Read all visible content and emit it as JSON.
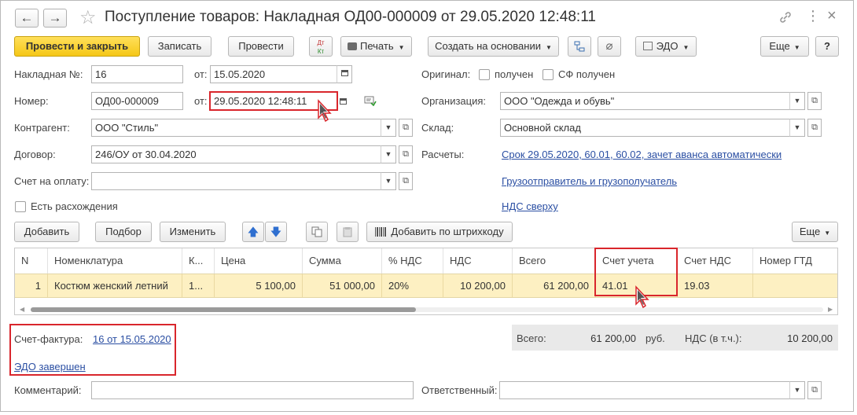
{
  "window": {
    "title": "Поступление товаров: Накладная ОД00-000009 от 29.05.2020 12:48:11",
    "nav_back": "←",
    "nav_forward": "→",
    "star": "☆",
    "link_icon": "🔗",
    "more_icon": "⋮",
    "close_icon": "×"
  },
  "toolbar": {
    "post_close": "Провести и закрыть",
    "save": "Записать",
    "post": "Провести",
    "dtkt_top": "Дт",
    "dtkt_bottom": "Кт",
    "print": "Печать",
    "create_based": "Создать на основании",
    "edo": "ЭДО",
    "more": "Еще",
    "help": "?"
  },
  "form": {
    "invoice_no_label": "Накладная №:",
    "invoice_no": "16",
    "from_label": "от:",
    "invoice_date": "15.05.2020",
    "number_label": "Номер:",
    "number": "ОД00-000009",
    "from_label2": "от:",
    "doc_date": "29.05.2020 12:48:11",
    "counterparty_label": "Контрагент:",
    "counterparty": "ООО \"Стиль\"",
    "contract_label": "Договор:",
    "contract": "246/ОУ от 30.04.2020",
    "payment_invoice_label": "Счет на оплату:",
    "payment_invoice": "",
    "discrepancy_label": "Есть расхождения",
    "original_label": "Оригинал:",
    "original_received": "получен",
    "sf_received": "СФ получен",
    "organization_label": "Организация:",
    "organization": "ООО \"Одежда и обувь\"",
    "warehouse_label": "Склад:",
    "warehouse": "Основной склад",
    "settlements_label": "Расчеты:",
    "settlements_link": "Срок 29.05.2020, 60.01, 60.02, зачет аванса автоматически",
    "shipper_link": "Грузоотправитель и грузополучатель",
    "vat_link": "НДС сверху"
  },
  "table_toolbar": {
    "add": "Добавить",
    "select": "Подбор",
    "change": "Изменить",
    "add_barcode": "Добавить по штрихкоду",
    "more": "Еще"
  },
  "table": {
    "columns": [
      "N",
      "Номенклатура",
      "К...",
      "Цена",
      "Сумма",
      "% НДС",
      "НДС",
      "Всего",
      "Счет учета",
      "Счет НДС",
      "Номер ГТД"
    ],
    "rows": [
      [
        "1",
        "Костюм женский летний",
        "1...",
        "5 100,00",
        "51 000,00",
        "20%",
        "10 200,00",
        "61 200,00",
        "41.01",
        "19.03",
        ""
      ]
    ]
  },
  "footer": {
    "invoice_label": "Счет-фактура:",
    "invoice_link": "16 от 15.05.2020",
    "edo_status": "ЭДО завершен",
    "total_label": "Всего:",
    "total_value": "61 200,00",
    "currency": "руб.",
    "vat_label": "НДС (в т.ч.):",
    "vat_value": "10 200,00",
    "comment_label": "Комментарий:",
    "comment": "",
    "responsible_label": "Ответственный:",
    "responsible": ""
  }
}
